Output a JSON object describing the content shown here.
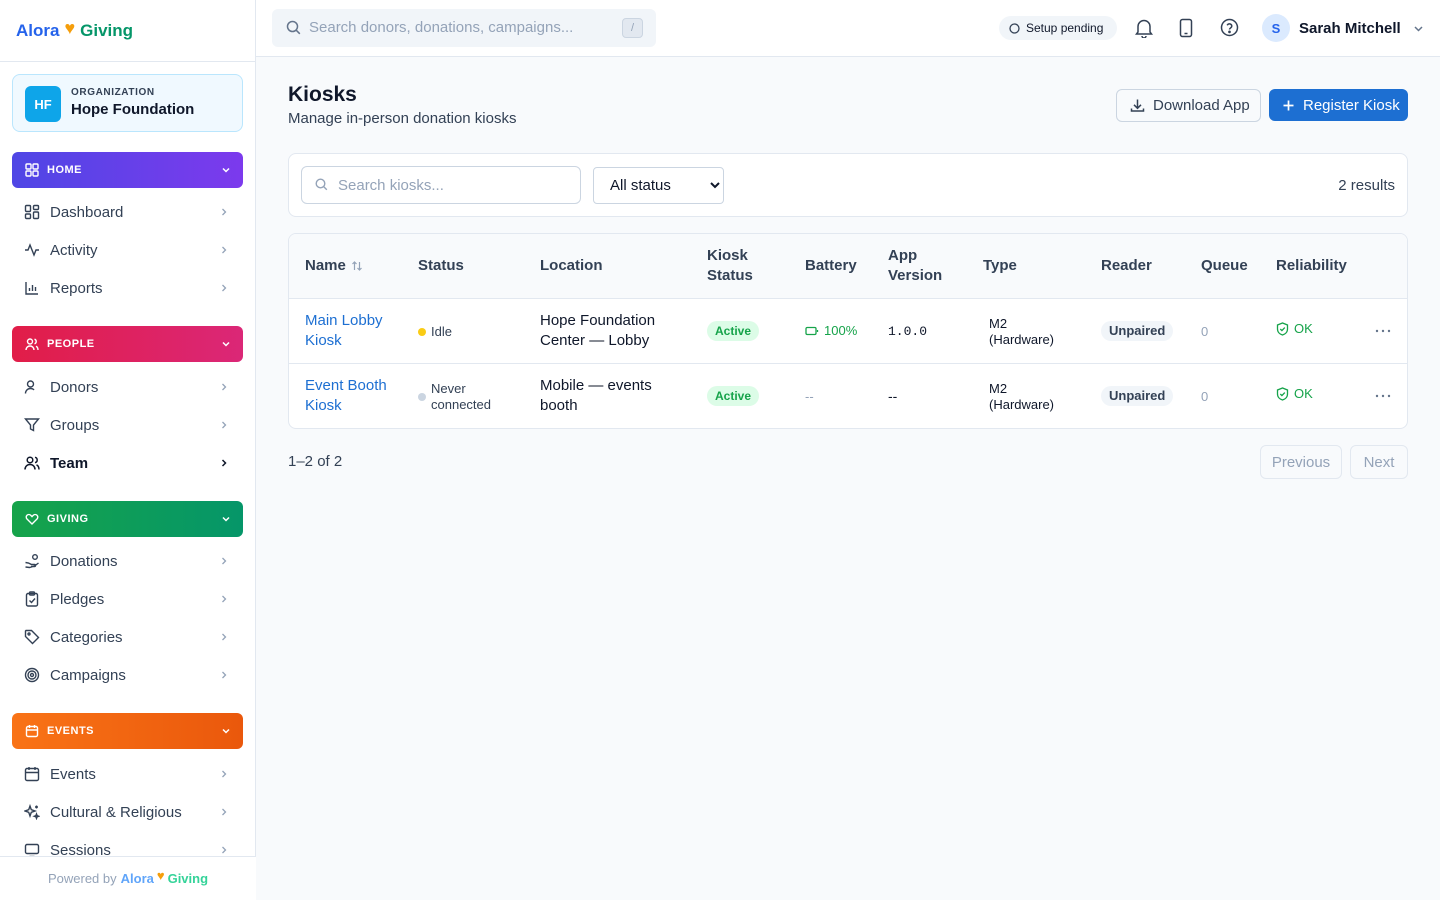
{
  "app": {
    "brand_left": "Alora",
    "brand_right": "Giving",
    "powered_by": "Powered by"
  },
  "org": {
    "label": "ORGANIZATION",
    "initials": "HF",
    "name": "Hope Foundation"
  },
  "sidebar": {
    "home": {
      "label": "HOME",
      "color": "#4f46e5",
      "items": [
        "Dashboard",
        "Activity",
        "Reports"
      ]
    },
    "people": {
      "label": "PEOPLE",
      "color": "#e11d48",
      "items": [
        "Donors",
        "Groups",
        "Team"
      ]
    },
    "giving": {
      "label": "GIVING",
      "color": "#16a34a",
      "items": [
        "Donations",
        "Pledges",
        "Categories",
        "Campaigns"
      ]
    },
    "events": {
      "label": "EVENTS",
      "color": "#f97316",
      "items": [
        "Events",
        "Cultural & Religious",
        "Sessions"
      ]
    },
    "active_item": "Team"
  },
  "topbar": {
    "search_placeholder": "Search donors, donations, campaigns...",
    "search_shortcut": "/",
    "setup_status": "Setup pending",
    "user_initial": "S",
    "user_name": "Sarah Mitchell"
  },
  "page": {
    "title": "Kiosks",
    "subtitle": "Manage in-person donation kiosks",
    "download_label": "Download App",
    "register_label": "Register Kiosk"
  },
  "filters": {
    "search_placeholder": "Search kiosks...",
    "status_selected": "All status",
    "results": "2 results"
  },
  "table": {
    "columns": {
      "name": "Name",
      "status": "Status",
      "location": "Location",
      "kiosk_status_1": "Kiosk",
      "kiosk_status_2": "Status",
      "battery": "Battery",
      "app_version_1": "App",
      "app_version_2": "Version",
      "type": "Type",
      "reader": "Reader",
      "queue": "Queue",
      "reliability": "Reliability"
    },
    "rows": [
      {
        "name_1": "Main Lobby",
        "name_2": "Kiosk",
        "status_1": "Idle",
        "status_2": "",
        "status_color": "#facc15",
        "location_1": "Hope Foundation",
        "location_2": "Center — Lobby",
        "kiosk_status": "Active",
        "battery": "100%",
        "app_version": "1.0.0",
        "type_1": "M2",
        "type_2": "(Hardware)",
        "reader": "Unpaired",
        "queue": "0",
        "reliability": "OK"
      },
      {
        "name_1": "Event Booth",
        "name_2": "Kiosk",
        "status_1": "Never",
        "status_2": "connected",
        "status_color": "#cbd5e1",
        "location_1": "Mobile — events",
        "location_2": "booth",
        "kiosk_status": "Active",
        "battery": "--",
        "app_version": "--",
        "type_1": "M2",
        "type_2": "(Hardware)",
        "reader": "Unpaired",
        "queue": "0",
        "reliability": "OK"
      }
    ]
  },
  "pagination": {
    "range": "1–2 of 2",
    "previous": "Previous",
    "next": "Next"
  }
}
